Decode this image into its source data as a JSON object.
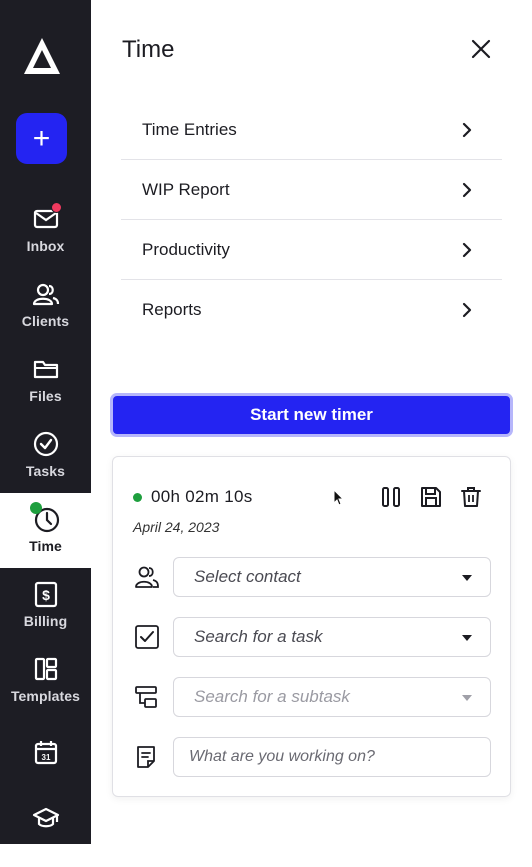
{
  "sidebar": {
    "add_label": "+",
    "items": [
      {
        "label": "Inbox",
        "icon": "envelope-icon"
      },
      {
        "label": "Clients",
        "icon": "users-icon"
      },
      {
        "label": "Files",
        "icon": "folder-icon"
      },
      {
        "label": "Tasks",
        "icon": "check-circle-icon"
      },
      {
        "label": "Time",
        "icon": "clock-icon",
        "active": true
      },
      {
        "label": "Billing",
        "icon": "dollar-icon"
      },
      {
        "label": "Templates",
        "icon": "templates-icon"
      },
      {
        "label": "",
        "icon": "calendar-icon",
        "calendar_day": "31"
      },
      {
        "label": "",
        "icon": "graduation-cap-icon"
      }
    ]
  },
  "panel": {
    "title": "Time",
    "menu": [
      {
        "label": "Time Entries"
      },
      {
        "label": "WIP Report"
      },
      {
        "label": "Productivity"
      },
      {
        "label": "Reports"
      }
    ],
    "start_button": "Start new timer"
  },
  "timer": {
    "elapsed": "00h 02m 10s",
    "date": "April 24, 2023",
    "status_color": "#1e9f3e",
    "contact_placeholder": "Select contact",
    "task_placeholder": "Search for a task",
    "subtask_placeholder": "Search for a subtask",
    "note_placeholder": "What are you working on?"
  },
  "colors": {
    "accent": "#2424f2",
    "sidebar_bg": "#1d1d24",
    "badge": "#f03a5f"
  }
}
